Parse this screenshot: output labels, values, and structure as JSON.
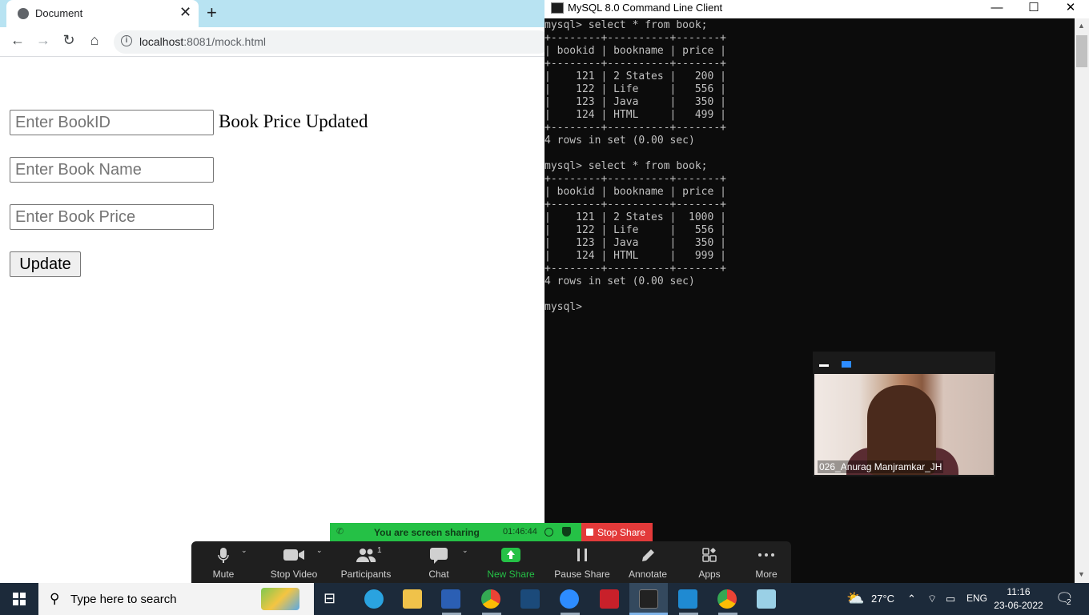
{
  "browser": {
    "tab_title": "Document",
    "close_glyph": "✕",
    "newtab_glyph": "+",
    "url_host": "localhost",
    "url_rest": ":8081/mock.html",
    "nav": {
      "back": "←",
      "forward": "→",
      "reload": "↻",
      "home": "⌂"
    }
  },
  "form": {
    "bookid_placeholder": "Enter BookID",
    "bookname_placeholder": "Enter Book Name",
    "bookprice_placeholder": "Enter Book Price",
    "update_label": "Update",
    "status_text": "Book Price Updated"
  },
  "mysql": {
    "window_title": "MySQL 8.0 Command Line Client",
    "controls": {
      "minimize": "—",
      "maximize": "☐",
      "close": "✕"
    },
    "console_lines": [
      "mysql> select * from book;",
      "+--------+----------+-------+",
      "| bookid | bookname | price |",
      "+--------+----------+-------+",
      "|    121 | 2 States |   200 |",
      "|    122 | Life     |   556 |",
      "|    123 | Java     |   350 |",
      "|    124 | HTML     |   499 |",
      "+--------+----------+-------+",
      "4 rows in set (0.00 sec)",
      "",
      "mysql> select * from book;",
      "+--------+----------+-------+",
      "| bookid | bookname | price |",
      "+--------+----------+-------+",
      "|    121 | 2 States |  1000 |",
      "|    122 | Life     |   556 |",
      "|    123 | Java     |   350 |",
      "|    124 | HTML     |   999 |",
      "+--------+----------+-------+",
      "4 rows in set (0.00 sec)",
      "",
      "mysql>"
    ]
  },
  "video": {
    "participant_name": "026_Anurag Manjramkar_JH"
  },
  "sharing": {
    "banner_text": "You are screen sharing",
    "elapsed": "01:46:44",
    "stop_share_label": "Stop Share"
  },
  "zoom_toolbar": {
    "participants_count": "1",
    "buttons": [
      {
        "label": "Mute",
        "icon": "microphone-icon"
      },
      {
        "label": "Stop Video",
        "icon": "video-camera-icon"
      },
      {
        "label": "Participants",
        "icon": "participants-icon"
      },
      {
        "label": "Chat",
        "icon": "chat-icon"
      },
      {
        "label": "New Share",
        "icon": "share-up-arrow-icon"
      },
      {
        "label": "Pause Share",
        "icon": "pause-icon"
      },
      {
        "label": "Annotate",
        "icon": "pencil-icon"
      },
      {
        "label": "Apps",
        "icon": "apps-icon"
      },
      {
        "label": "More",
        "icon": "more-dots-icon"
      }
    ],
    "colors": {
      "new_share": "#25c146",
      "banner": "#25c146",
      "stop_share": "#e33a3a"
    }
  },
  "taskbar": {
    "search_placeholder": "Type here to search",
    "weather": "27°C",
    "language": "ENG",
    "time": "11:16",
    "date": "23-06-2022",
    "notification_count": "2"
  }
}
